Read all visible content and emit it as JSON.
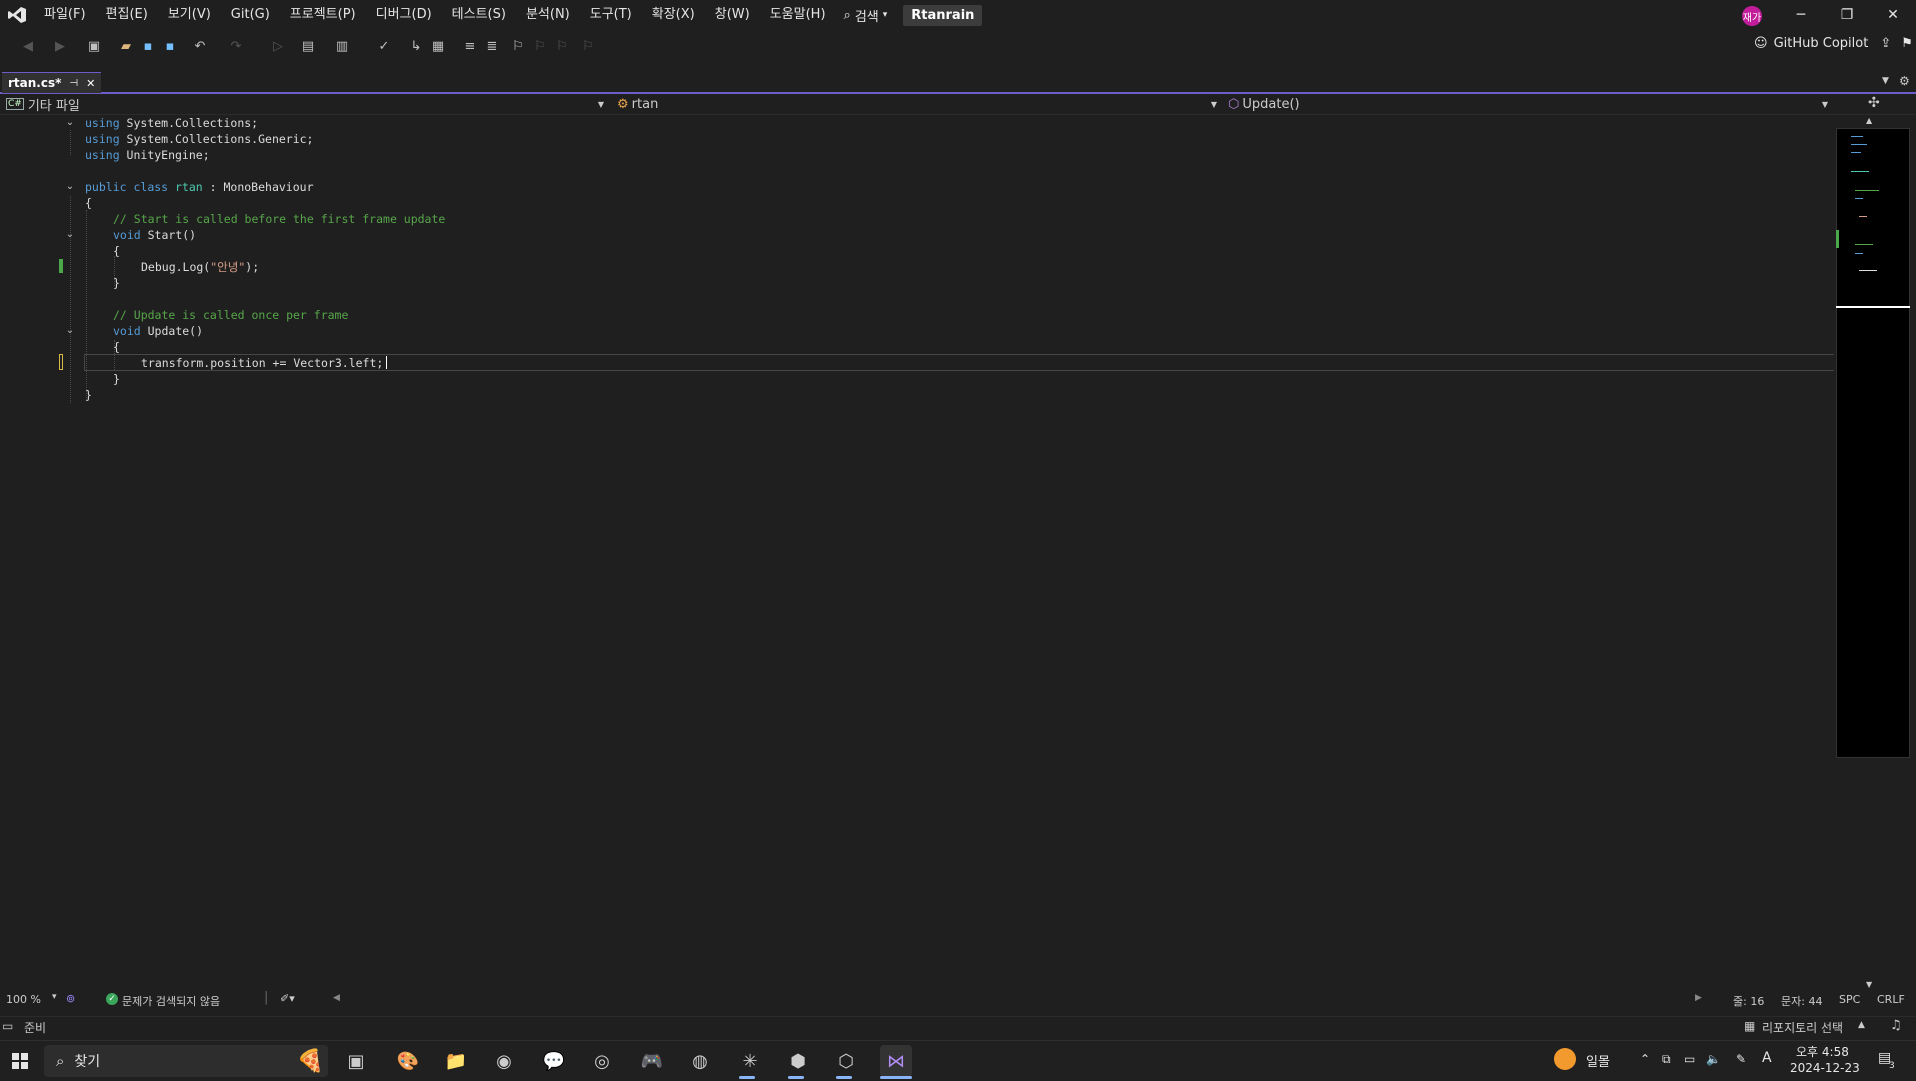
{
  "menubar": {
    "items": [
      "파일(F)",
      "편집(E)",
      "보기(V)",
      "Git(G)",
      "프로젝트(P)",
      "디버그(D)",
      "테스트(S)",
      "분석(N)",
      "도구(T)",
      "확장(X)",
      "창(W)",
      "도움말(H)"
    ],
    "search_label": "검색",
    "solution_name": "Rtanrain",
    "avatar_initials": "재가"
  },
  "toolbar": {
    "copilot_label": "GitHub Copilot"
  },
  "tab": {
    "title": "rtan.cs*"
  },
  "navbar": {
    "project": "기타 파일",
    "type": "rtan",
    "member": "Update()"
  },
  "code": {
    "l1_kw": "using",
    "l1_rest": " System.Collections;",
    "l2_kw": "using",
    "l2_rest": " System.Collections.Generic;",
    "l3_kw": "using",
    "l3_rest": " UnityEngine;",
    "l5_kw1": "public",
    "l5_kw2": " class",
    "l5_cls": " rtan",
    "l5_rest": " : MonoBehaviour",
    "l6": "{",
    "l7_cm": "// Start is called before the first frame update",
    "l8_kw": "void",
    "l8_rest": " Start()",
    "l9": "{",
    "l10_pre": "Debug.Log(",
    "l10_str": "\"안녕\"",
    "l10_post": ");",
    "l11": "}",
    "l13_cm": "// Update is called once per frame",
    "l14_kw": "void",
    "l14_rest": " Update()",
    "l15": "{",
    "l16": "transform.position += Vector3.left;",
    "l17": "}",
    "l18": "}"
  },
  "editor_status": {
    "zoom": "100 %",
    "issues": "문제가 검색되지 않음",
    "line": "줄: 16",
    "char": "문자: 44",
    "indent": "SPC",
    "eol": "CRLF"
  },
  "statusbar": {
    "ready": "준비",
    "repo": "리포지토리 선택"
  },
  "taskbar": {
    "search_placeholder": "찾기",
    "weather": "일몰",
    "time": "오후 4:58",
    "date": "2024-12-23",
    "notifications": "3",
    "ime": "A"
  },
  "colors": {
    "accent": "#6c5ec9",
    "keyword": "#569cd6",
    "type": "#4ec9b0",
    "comment": "#57a64a",
    "string": "#d69d85"
  }
}
